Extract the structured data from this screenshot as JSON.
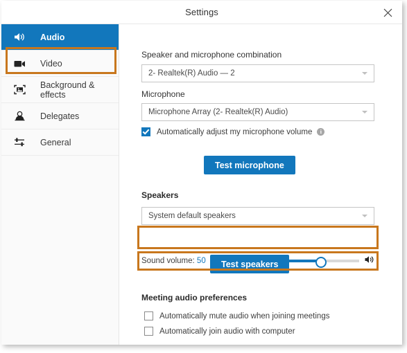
{
  "window": {
    "title": "Settings",
    "close_icon": "close-icon"
  },
  "theme": {
    "accent_blue": "#1277bc",
    "highlight_orange": "#c8771d",
    "sidebar_bg": "#fafafa",
    "text": "#333333"
  },
  "sidebar": {
    "items": [
      {
        "label": "Audio",
        "icon": "speaker-icon",
        "active": true
      },
      {
        "label": "Video",
        "icon": "video-camera-icon",
        "active": false
      },
      {
        "label": "Background & effects",
        "icon": "image-frame-icon",
        "active": false
      },
      {
        "label": "Delegates",
        "icon": "person-icon",
        "active": false
      },
      {
        "label": "General",
        "icon": "sliders-icon",
        "active": false
      }
    ]
  },
  "main": {
    "combination": {
      "label": "Speaker and microphone combination",
      "value": "2- Realtek(R) Audio — 2"
    },
    "microphone": {
      "label": "Microphone",
      "value": "Microphone Array (2- Realtek(R) Audio)"
    },
    "auto_adjust": {
      "label": "Automatically adjust my microphone volume",
      "checked": true,
      "info_glyph": "i"
    },
    "test_microphone_label": "Test microphone",
    "speakers": {
      "label": "Speakers",
      "value": "System default speakers"
    },
    "volume": {
      "label": "Sound volume:",
      "value": "50",
      "percent": 50,
      "mute_icon": "speaker-mute-icon",
      "loud_icon": "speaker-loud-icon"
    },
    "test_speakers_label": "Test speakers",
    "preferences": {
      "heading": "Meeting audio preferences",
      "options": [
        {
          "label": "Automatically mute audio when joining meetings",
          "checked": false
        },
        {
          "label": "Automatically join audio with computer",
          "checked": false
        }
      ]
    }
  }
}
